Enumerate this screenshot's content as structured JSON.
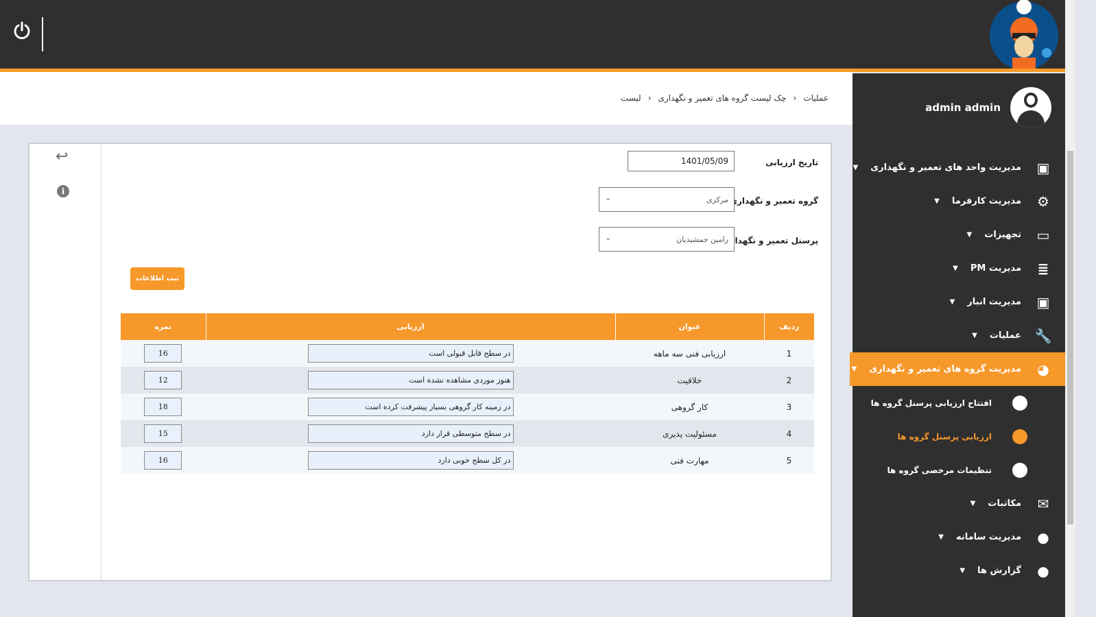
{
  "header": {
    "power_icon": "power-icon",
    "accent": "#f7982a"
  },
  "user": {
    "name": "admin admin"
  },
  "sidebar": {
    "items": [
      {
        "label": "مدیریت واحد های تعمیر و نگهداری",
        "icon": "calendar-plus-icon"
      },
      {
        "label": "مدیریت کارفرما",
        "icon": "gear-icon"
      },
      {
        "label": "تجهیزات",
        "icon": "monitor-icon"
      },
      {
        "label": "مدیریت PM",
        "icon": "database-icon"
      },
      {
        "label": "مدیریت انبار",
        "icon": "calendar-plus-icon"
      },
      {
        "label": "عملیات",
        "icon": "wrench-icon"
      },
      {
        "label": "مدیریت گروه های تعمیر و نگهداری",
        "icon": "pie-chart-icon"
      }
    ],
    "subitems": [
      {
        "label": "افتتاح ارزیابی پرسنل گروه ها"
      },
      {
        "label": "ارزیابی پرسنل گروه ها"
      },
      {
        "label": "تنظیمات مرخصی گروه ها"
      }
    ],
    "items2": [
      {
        "label": "مکاتبات",
        "icon": "envelope-icon"
      },
      {
        "label": "مدیریت سامانه",
        "icon": "user-icon"
      },
      {
        "label": "گزارش ها",
        "icon": "user-icon"
      }
    ]
  },
  "breadcrumb": [
    "عملیات",
    "چک لیست گروه های تعمیر و نگهداری",
    "لیست"
  ],
  "form": {
    "date_label": "تاریخ ارزیابی",
    "date_value": "1401/05/09",
    "group_label": "گروه تعمیر و نگهداری",
    "group_value": "مرکزی",
    "staff_label": "پرسنل تعمیر و نگهداری",
    "staff_value": "رامین جمشیدیان",
    "submit": "ثبت اطلاعات"
  },
  "table": {
    "headers": [
      "ردیف",
      "عنوان",
      "ارزیابی",
      "نمره"
    ],
    "rows": [
      [
        "1",
        "ارزیابی فنی سه ماهه",
        "در سطح قابل قبولی است",
        "16"
      ],
      [
        "2",
        "خلاقیت",
        "هنوز موردی مشاهده نشده است",
        "12"
      ],
      [
        "3",
        "کار گروهی",
        "در زمینه کار گروهی بسیار پیشرفت کرده است",
        "18"
      ],
      [
        "4",
        "مسئولیت پذیری",
        "در سطح متوسطی قرار دارد",
        "15"
      ],
      [
        "5",
        "مهارت فنی",
        "در کل سطح خوبی دارد",
        "16"
      ]
    ]
  }
}
